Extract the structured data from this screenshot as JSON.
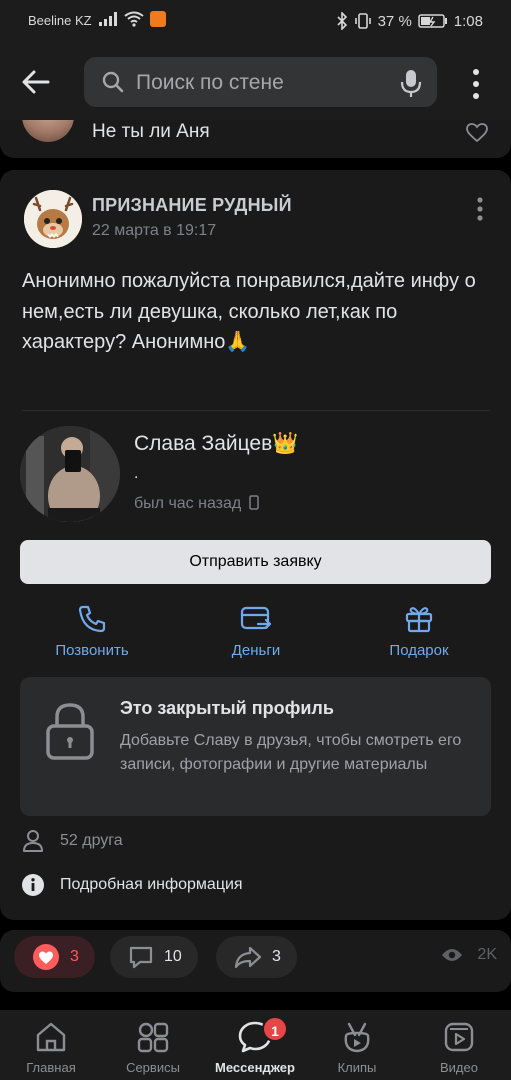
{
  "status_bar": {
    "carrier": "Beeline KZ",
    "battery_percent": "37 %",
    "time": "1:08"
  },
  "search": {
    "placeholder": "Поиск по стене"
  },
  "previous_item": {
    "text": "Не ты ли Аня"
  },
  "post": {
    "author": "ПРИЗНАНИЕ РУДНЫЙ",
    "date": "22 марта в 19:17",
    "text": "Анонимно пожалуйста понравился,дайте инфу о нем,есть ли девушка, сколько лет,как по характеру? Анонимно🙏",
    "profile": {
      "name": "Слава Зайцев👑",
      "status": ".",
      "last_seen": "был час назад"
    },
    "friend_button": "Отправить заявку",
    "actions": [
      {
        "label": "Позвонить",
        "icon": "phone-icon"
      },
      {
        "label": "Деньги",
        "icon": "money-transfer-icon"
      },
      {
        "label": "Подарок",
        "icon": "gift-icon"
      }
    ],
    "closed_profile": {
      "title": "Это закрытый профиль",
      "description": "Добавьте Славу в друзья, чтобы смотреть его записи, фотографии и другие материалы"
    },
    "friends": "52 друга",
    "details": "Подробная информация"
  },
  "reactions": {
    "likes": "3",
    "comments": "10",
    "shares": "3",
    "views": "2K"
  },
  "tabbar": {
    "items": [
      {
        "label": "Главная",
        "icon": "home-icon"
      },
      {
        "label": "Сервисы",
        "icon": "services-icon"
      },
      {
        "label": "Мессенджер",
        "icon": "messenger-icon",
        "badge": "1"
      },
      {
        "label": "Клипы",
        "icon": "clips-icon"
      },
      {
        "label": "Видео",
        "icon": "video-icon"
      }
    ]
  },
  "colors": {
    "accent": "#71aaeb",
    "like": "#ff5c5c",
    "badge": "#e64646",
    "background": "#000000",
    "card": "#1a1a1a"
  }
}
